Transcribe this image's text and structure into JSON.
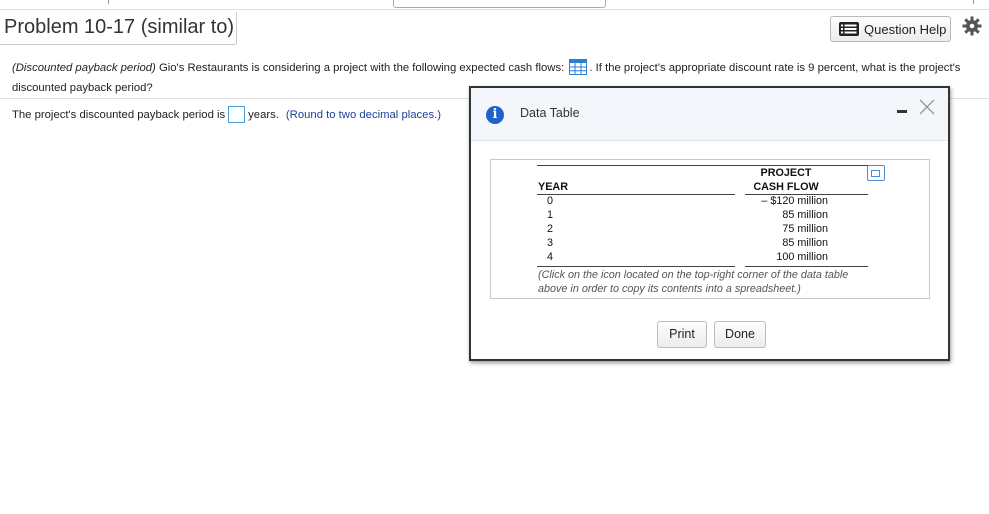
{
  "header": {
    "title": "Problem 10-17 (similar to)",
    "help_button": "Question Help"
  },
  "question": {
    "topic": "(Discounted payback period)",
    "text_before_icon": " Gio's Restaurants is considering a project with the following expected cash flows: ",
    "text_after_icon": ". If the project's appropriate discount rate is 9 percent, what is the project's discounted payback period?"
  },
  "answer": {
    "prefix": "The project's discounted payback period is",
    "value": "",
    "suffix": "years.",
    "hint": "(Round to two decimal places.)"
  },
  "dialog": {
    "title": "Data Table",
    "table": {
      "col_year": "YEAR",
      "col_cf_line1": "PROJECT",
      "col_cf_line2": "CASH FLOW",
      "rows": [
        {
          "year": "0",
          "cash_flow": "– $120 million"
        },
        {
          "year": "1",
          "cash_flow": "85 million"
        },
        {
          "year": "2",
          "cash_flow": "75 million"
        },
        {
          "year": "3",
          "cash_flow": "85 million"
        },
        {
          "year": "4",
          "cash_flow": "100 million"
        }
      ],
      "note": "(Click on the icon located on the top-right corner of the data table above in order to copy its contents into a spreadsheet.)"
    },
    "print_button": "Print",
    "done_button": "Done"
  },
  "colors": {
    "info_icon": "#1f63c8",
    "hint_text": "#1f3f9a",
    "input_border": "#4a9ed6"
  }
}
